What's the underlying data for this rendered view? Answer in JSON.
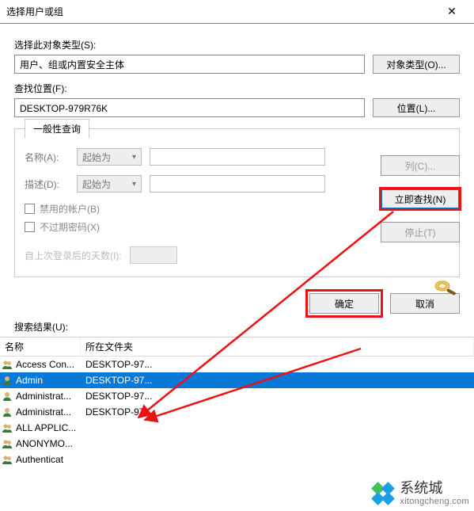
{
  "window": {
    "title": "选择用户或组"
  },
  "section_object_type": {
    "label": "选择此对象类型(S):",
    "value": "用户、组或内置安全主体",
    "button": "对象类型(O)..."
  },
  "section_location": {
    "label": "查找位置(F):",
    "value": "DESKTOP-979R76K",
    "button": "位置(L)..."
  },
  "query": {
    "tab": "一般性查询",
    "name_label": "名称(A):",
    "name_combo": "起始为",
    "desc_label": "描述(D):",
    "desc_combo": "起始为",
    "chk_disabled": "禁用的帐户(B)",
    "chk_noexpire": "不过期密码(X)",
    "days_label": "自上次登录后的天数(I):"
  },
  "rightcol": {
    "columns": "列(C)...",
    "findnow": "立即查找(N)",
    "stop": "停止(T)"
  },
  "actions": {
    "ok": "确定",
    "cancel": "取消"
  },
  "results": {
    "label": "搜索结果(U):",
    "header_name": "名称",
    "header_location": "所在文件夹",
    "rows": [
      {
        "name": "Access Con...",
        "loc": "DESKTOP-97..."
      },
      {
        "name": "Admin",
        "loc": "DESKTOP-97..."
      },
      {
        "name": "Administrat...",
        "loc": "DESKTOP-97..."
      },
      {
        "name": "Administrat...",
        "loc": "DESKTOP-97..."
      },
      {
        "name": "ALL APPLIC...",
        "loc": ""
      },
      {
        "name": "ANONYMO...",
        "loc": ""
      },
      {
        "name": "Authenticat",
        "loc": ""
      }
    ],
    "selected_index": 1
  },
  "watermark": {
    "name": "系统城",
    "url": "xitongcheng.com"
  }
}
